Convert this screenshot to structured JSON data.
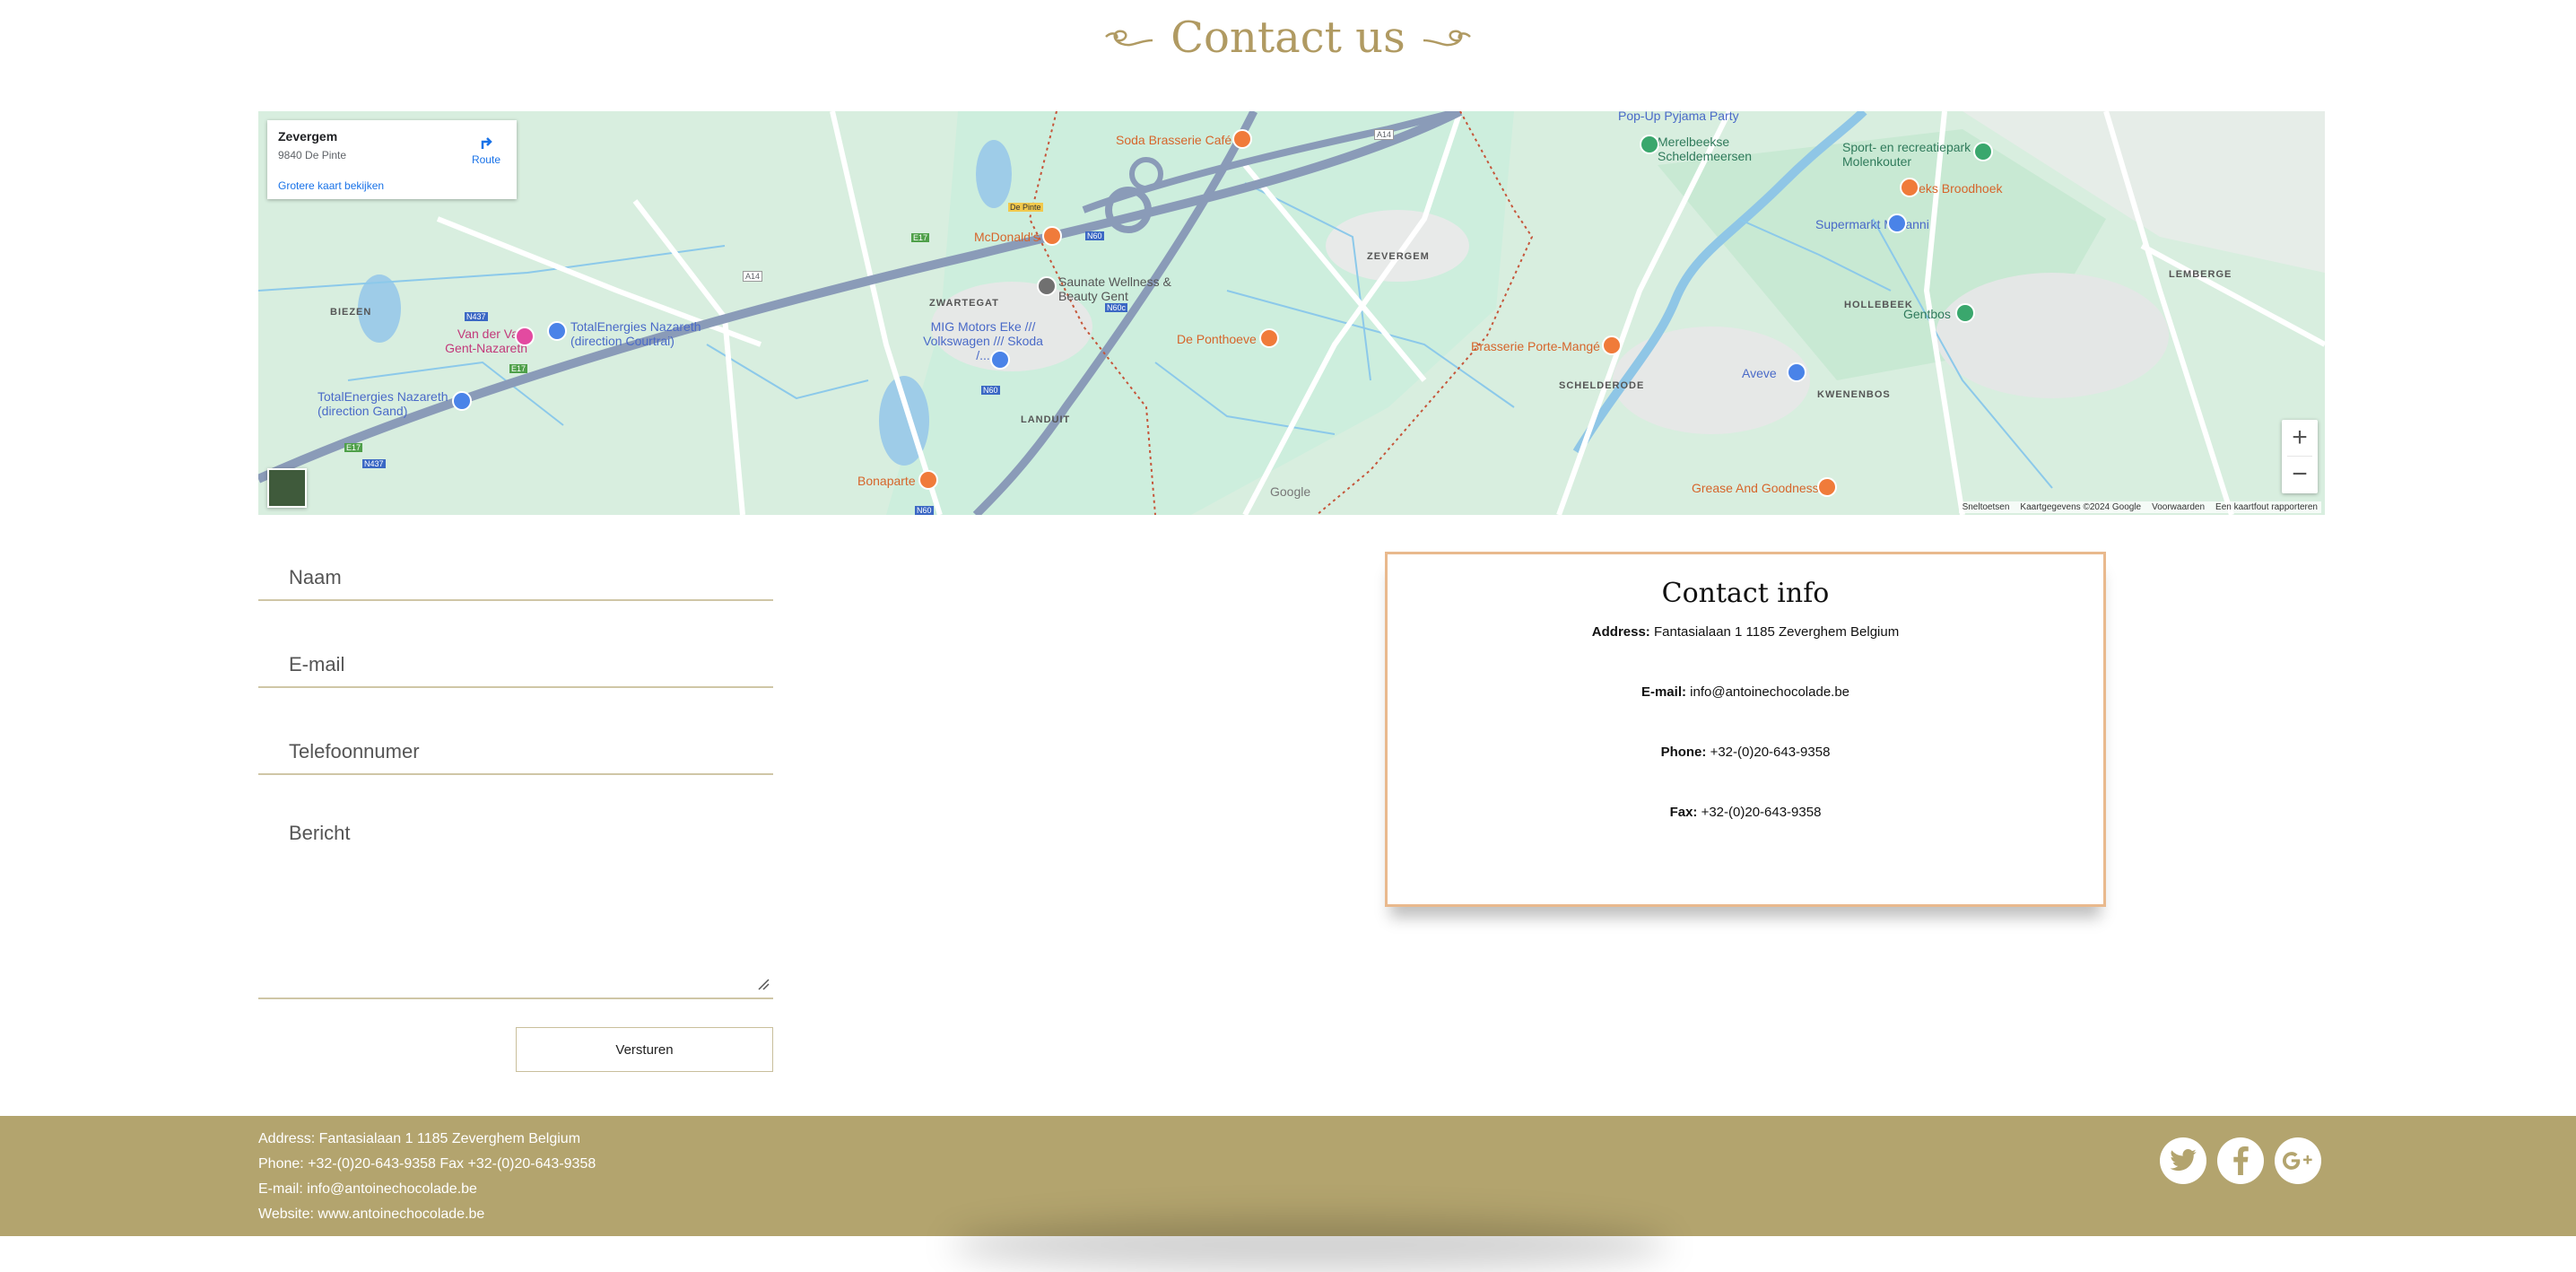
{
  "page": {
    "title": "Contact us"
  },
  "map": {
    "infobox": {
      "name": "Zevergem",
      "address": "9840 De Pinte",
      "route_label": "Route",
      "larger_map_link": "Grotere kaart bekijken"
    },
    "places": [
      "ZEVERGEM",
      "ZWARTEGAT",
      "BIEZEN",
      "LANDUIT",
      "HOLLEBEEK",
      "SCHELDERODE",
      "KWENENBOS",
      "LEMBERGE"
    ],
    "pois": {
      "soda": "Soda Brasserie Café",
      "popup": "Pop-Up Pyjama Party",
      "merelbeke": "Merelbeekse Scheldemeersen",
      "sport": "Sport- en recreatiepark Molenkouter",
      "brieks": "Brieks Broodhoek",
      "supermarkt": "Supermarkt Maranni",
      "mcdonalds": "McDonald's",
      "saunate": "Saunate Wellness & Beauty Gent",
      "mig": "MIG Motors Eke /// Volkswagen /// Skoda /...",
      "ponthoeve": "De Ponthoeve",
      "porte": "Brasserie Porte-Mangé",
      "aveve": "Aveve",
      "gentbos": "Gentbos",
      "vandervalk": "Van der Valk Gent-Nazareth",
      "total1": "TotalEnergies Nazareth (direction Courtrai)",
      "total2": "TotalEnergies Nazareth (direction Gand)",
      "bonaparte": "Bonaparte",
      "grease": "Grease And Goodness",
      "depinte": "De Pinte"
    },
    "roads": [
      "A14",
      "E17",
      "N60",
      "N437",
      "N60c"
    ],
    "attribution": [
      "Sneltoetsen",
      "Kaartgegevens ©2024 Google",
      "Voorwaarden",
      "Een kaartfout rapporteren"
    ],
    "zoom_in": "+",
    "zoom_out": "−"
  },
  "form": {
    "name_placeholder": "Naam",
    "email_placeholder": "E-mail",
    "phone_placeholder": "Telefoonnumer",
    "message_placeholder": "Bericht",
    "submit_label": "Versturen"
  },
  "contact_info": {
    "title": "Contact info",
    "address_label": "Address:",
    "address_value": "Fantasialaan 1 1185 Zeverghem Belgium",
    "email_label": "E-mail:",
    "email_value": "info@antoinechocolade.be",
    "phone_label": "Phone:",
    "phone_value": "+32-(0)20-643-9358",
    "fax_label": "Fax:",
    "fax_value": "+32-(0)20-643-9358"
  },
  "footer": {
    "address": "Address: Fantasialaan 1 1185 Zeverghem Belgium",
    "phone_fax": "Phone: +32-(0)20-643-9358 Fax +32-(0)20-643-9358",
    "email": "E-mail: info@antoinechocolade.be",
    "website": "Website: www.antoinechocolade.be",
    "social_icons": [
      "twitter-icon",
      "facebook-icon",
      "google-plus-icon"
    ]
  },
  "colors": {
    "gold": "#b09a62",
    "footer_bg": "#b3a46e",
    "card_border": "#e9b98d"
  }
}
